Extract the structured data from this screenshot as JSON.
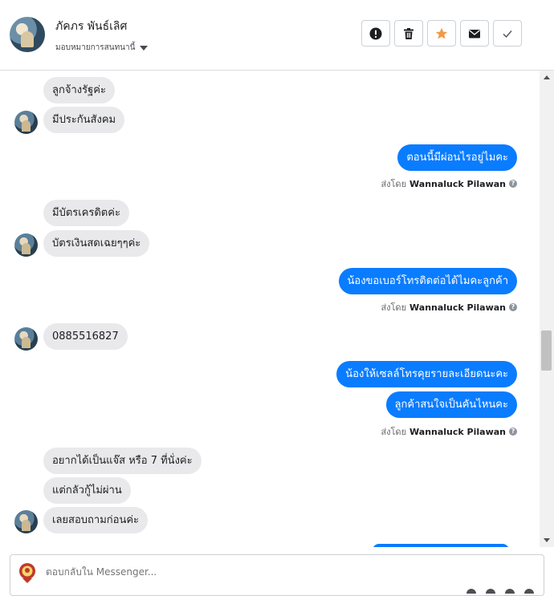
{
  "header": {
    "contact_name": "ภัคภร พันธ์เลิศ",
    "assign_label": "มอบหมายการสนทนานี้",
    "actions": [
      {
        "name": "mark-spam-button",
        "icon": "exclamation-circle-icon",
        "color": "#1c1e21"
      },
      {
        "name": "delete-button",
        "icon": "trash-icon",
        "color": "#1c1e21"
      },
      {
        "name": "star-button",
        "icon": "star-icon",
        "color": "#f2994a"
      },
      {
        "name": "mark-unread-button",
        "icon": "envelope-icon",
        "color": "#1c1e21"
      },
      {
        "name": "mark-done-button",
        "icon": "check-icon",
        "color": "#1c1e21"
      }
    ]
  },
  "messages": {
    "m1": "ลูกจ้างรัฐค่ะ",
    "m2": "มีประกันสังคม",
    "m3": "ตอนนี้มีผ่อนไรอยู่ไมคะ",
    "m4": "มีบัตรเครดิตค่ะ",
    "m5": "บัตรเงินสดเฉยๆๆค่ะ",
    "m6": "น้องขอเบอร์โทรติดต่อได้ไมคะลูกค้า",
    "m7": "0885516827",
    "m8": "น้องให้เซลล์โทรคุยรายละเอียดนะคะ",
    "m9": "ลูกค้าสนใจเป็นคันไหนคะ",
    "m10": "อยากได้เป็นแจ๊ส หรือ 7 ที่นั่งค่ะ",
    "m11": "แต่กลัวกู้ไม่ผ่าน",
    "m12": "เลยสอบถามก่อนค่ะ"
  },
  "sent_by": {
    "prefix": "ส่งโดย",
    "agent": "Wannaluck Pilawan",
    "help_glyph": "?"
  },
  "composer": {
    "placeholder": "ตอบกลับใน Messenger..."
  },
  "colors": {
    "outgoing_bubble": "#0a7cff",
    "incoming_bubble": "#e9e9eb",
    "star_accent": "#f2994a"
  }
}
